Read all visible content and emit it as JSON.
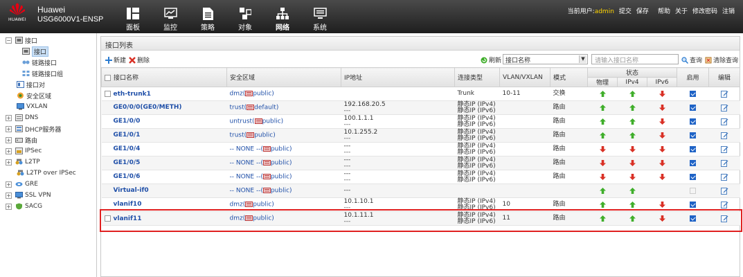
{
  "header": {
    "logo_text": "HUAWEI",
    "product_line1": "Huawei",
    "product_line2": "USG6000V1-ENSP",
    "nav": [
      {
        "label": "面板",
        "icon": "dashboard-icon"
      },
      {
        "label": "监控",
        "icon": "monitor-icon"
      },
      {
        "label": "策略",
        "icon": "policy-icon"
      },
      {
        "label": "对象",
        "icon": "object-icon"
      },
      {
        "label": "网络",
        "icon": "network-icon",
        "active": true
      },
      {
        "label": "系统",
        "icon": "system-icon"
      }
    ],
    "user_label": "当前用户:",
    "user_name": "admin",
    "links": [
      "提交",
      "保存",
      "帮助",
      "关于",
      "修改密码",
      "注销"
    ]
  },
  "tree": [
    {
      "label": "接口",
      "expand": "−"
    },
    {
      "label": "接口",
      "selected": true
    },
    {
      "label": "链路接口"
    },
    {
      "label": "链路接口组"
    },
    {
      "label": "接口对"
    },
    {
      "label": "安全区域"
    },
    {
      "label": "VXLAN"
    },
    {
      "label": "DNS",
      "expand": "+"
    },
    {
      "label": "DHCP服务器",
      "expand": "+"
    },
    {
      "label": "路由",
      "expand": "+"
    },
    {
      "label": "IPSec",
      "expand": "+"
    },
    {
      "label": "L2TP",
      "expand": "+"
    },
    {
      "label": "L2TP over IPSec"
    },
    {
      "label": "GRE",
      "expand": "+"
    },
    {
      "label": "SSL VPN",
      "expand": "+"
    },
    {
      "label": "SACG",
      "expand": "+"
    }
  ],
  "panel": {
    "title": "接口列表",
    "new_label": "新建",
    "delete_label": "删除",
    "refresh_label": "刷新",
    "filter_selected": "接口名称",
    "search_placeholder": "请输入接口名称",
    "query_label": "查询",
    "clear_label": "清除查询"
  },
  "columns": {
    "name": "接口名称",
    "zone": "安全区域",
    "ip": "IP地址",
    "conn": "连接类型",
    "vlan": "VLAN/VXLAN",
    "mode": "模式",
    "status": "状态",
    "physical": "物理",
    "ipv4": "IPv4",
    "ipv6": "IPv6",
    "enable": "启用",
    "edit": "编辑"
  },
  "rows": [
    {
      "name": "eth-trunk1",
      "zone": "dmz(",
      "vsys": "public)",
      "ip1": "",
      "ip2": "",
      "conn1": "Trunk",
      "conn2": "",
      "vlan": "10-11",
      "mode": "交换",
      "phy": "up",
      "v4": "up",
      "v6": "down",
      "enabled": true,
      "checkbox": true
    },
    {
      "name": "GE0/0/0(GE0/METH)",
      "zone": "trust(",
      "vsys": "default)",
      "ip1": "192.168.20.5",
      "ip2": "---",
      "conn1": "静态IP (IPv4)",
      "conn2": "静态IP (IPv6)",
      "vlan": "",
      "mode": "路由",
      "phy": "up",
      "v4": "up",
      "v6": "down",
      "enabled": true,
      "checkbox": false
    },
    {
      "name": "GE1/0/0",
      "zone": "untrust(",
      "vsys": "public)",
      "ip1": "100.1.1.1",
      "ip2": "---",
      "conn1": "静态IP (IPv4)",
      "conn2": "静态IP (IPv6)",
      "vlan": "",
      "mode": "路由",
      "phy": "up",
      "v4": "up",
      "v6": "down",
      "enabled": true,
      "checkbox": false
    },
    {
      "name": "GE1/0/1",
      "zone": "trust(",
      "vsys": "public)",
      "ip1": "10.1.255.2",
      "ip2": "---",
      "conn1": "静态IP (IPv4)",
      "conn2": "静态IP (IPv6)",
      "vlan": "",
      "mode": "路由",
      "phy": "up",
      "v4": "up",
      "v6": "down",
      "enabled": true,
      "checkbox": false
    },
    {
      "name": "GE1/0/4",
      "zone": "-- NONE --(",
      "vsys": "public)",
      "ip1": "---",
      "ip2": "---",
      "conn1": "静态IP (IPv4)",
      "conn2": "静态IP (IPv6)",
      "vlan": "",
      "mode": "路由",
      "phy": "down",
      "v4": "down",
      "v6": "down",
      "enabled": true,
      "checkbox": false
    },
    {
      "name": "GE1/0/5",
      "zone": "-- NONE --(",
      "vsys": "public)",
      "ip1": "---",
      "ip2": "---",
      "conn1": "静态IP (IPv4)",
      "conn2": "静态IP (IPv6)",
      "vlan": "",
      "mode": "路由",
      "phy": "down",
      "v4": "down",
      "v6": "down",
      "enabled": true,
      "checkbox": false
    },
    {
      "name": "GE1/0/6",
      "zone": "-- NONE --(",
      "vsys": "public)",
      "ip1": "---",
      "ip2": "---",
      "conn1": "静态IP (IPv4)",
      "conn2": "静态IP (IPv6)",
      "vlan": "",
      "mode": "路由",
      "phy": "down",
      "v4": "down",
      "v6": "down",
      "enabled": true,
      "checkbox": false
    },
    {
      "name": "Virtual-if0",
      "zone": "-- NONE --(",
      "vsys": "public)",
      "ip1": "---",
      "ip2": "",
      "conn1": "",
      "conn2": "",
      "vlan": "",
      "mode": "",
      "phy": "up",
      "v4": "up",
      "v6": "",
      "enabled": false,
      "checkbox": false
    },
    {
      "name": "vlanif10",
      "zone": "dmz(",
      "vsys": "public)",
      "ip1": "10.1.10.1",
      "ip2": "---",
      "conn1": "静态IP (IPv4)",
      "conn2": "静态IP (IPv6)",
      "vlan": "10",
      "mode": "路由",
      "phy": "up",
      "v4": "up",
      "v6": "down",
      "enabled": true,
      "checkbox": false
    },
    {
      "name": "vlanif11",
      "zone": "dmz(",
      "vsys": "public)",
      "ip1": "10.1.11.1",
      "ip2": "---",
      "conn1": "静态IP (IPv4)",
      "conn2": "静态IP (IPv6)",
      "vlan": "11",
      "mode": "路由",
      "phy": "up",
      "v4": "up",
      "v6": "down",
      "enabled": true,
      "checkbox": true
    }
  ],
  "colors": {
    "up": "#3fae2a",
    "down": "#d93025",
    "link": "#1f4fa8",
    "highlight": "#e02020"
  }
}
